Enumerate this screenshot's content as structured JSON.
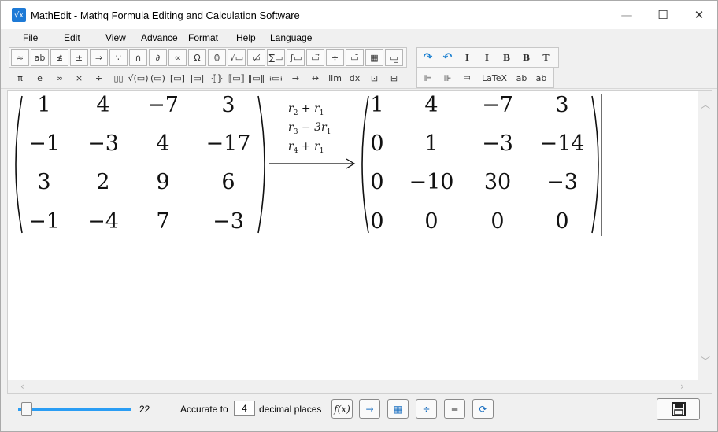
{
  "window": {
    "title": "MathEdit - Mathq Formula Editing and Calculation Software",
    "app_icon_glyph": "√x"
  },
  "menu": [
    "File",
    "Edit",
    "View",
    "Advance",
    "Format",
    "Help",
    "Language"
  ],
  "toolbar": {
    "row1": [
      "≈",
      "ab",
      "≰",
      "±",
      "⇒",
      "∵",
      "∩",
      "∂",
      "∝",
      "Ω",
      "⦅⦆",
      "√▭",
      "▭̸",
      "∑▭",
      "∫▭",
      "▭⃗",
      "÷",
      "▭̄",
      "▦",
      "▭̲"
    ],
    "row2": [
      "π",
      "e",
      "∞",
      "×",
      "÷",
      "▯▯",
      "√(▭)",
      "(▭)",
      "[▭]",
      "|▭|",
      "⦃⦄",
      "⟦▭⟧",
      "‖▭‖",
      "⁝▭⁝",
      "→",
      "↔",
      "lim",
      "dx",
      "⊡",
      "⊞"
    ],
    "format_row1": [
      "↷",
      "↶",
      "I",
      "I",
      "B",
      "B",
      "T"
    ],
    "format_row2": [
      "⊫",
      "⊪",
      "⫤",
      "LaTeX",
      "ab",
      "ab"
    ]
  },
  "editor": {
    "left_matrix": [
      [
        "1",
        "4",
        "−7",
        "3"
      ],
      [
        "−1",
        "−3",
        "4",
        "−17"
      ],
      [
        "3",
        "2",
        "9",
        "6"
      ],
      [
        "−1",
        "−4",
        "7",
        "−3"
      ]
    ],
    "operations": [
      {
        "a": "r",
        "a_sub": "2",
        "op": "+",
        "b": "r",
        "b_sub": "1"
      },
      {
        "a": "r",
        "a_sub": "3",
        "op": "−",
        "b": "3r",
        "b_sub": "1"
      },
      {
        "a": "r",
        "a_sub": "4",
        "op": "+",
        "b": "r",
        "b_sub": "1"
      }
    ],
    "right_matrix": [
      [
        "1",
        "4",
        "−7",
        "3"
      ],
      [
        "0",
        "1",
        "−3",
        "−14"
      ],
      [
        "0",
        "−10",
        "30",
        "−3"
      ],
      [
        "0",
        "0",
        "0",
        "0"
      ]
    ]
  },
  "statusbar": {
    "zoom_value": "22",
    "zoom_slider_fraction": 0.05,
    "accurate_label": "Accurate to",
    "decimal_places_value": "4",
    "decimal_label": "decimal places",
    "buttons": [
      "f(x)",
      "→",
      "▦",
      "÷",
      "═",
      "⟳"
    ]
  }
}
